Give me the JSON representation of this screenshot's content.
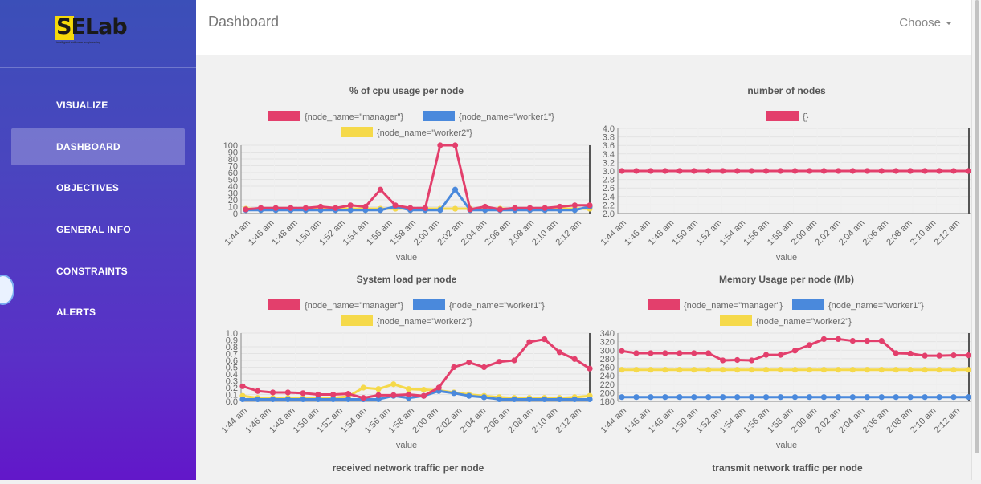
{
  "logo": {
    "text": "SELab",
    "tagline": "intelligent software engineering"
  },
  "sidebar": {
    "items": [
      {
        "label": "VISUALIZE",
        "active": false
      },
      {
        "label": "DASHBOARD",
        "active": true
      },
      {
        "label": "OBJECTIVES",
        "active": false
      },
      {
        "label": "GENERAL INFO",
        "active": false
      },
      {
        "label": "CONSTRAINTS",
        "active": false
      },
      {
        "label": "ALERTS",
        "active": false
      }
    ]
  },
  "header": {
    "title": "Dashboard",
    "choose_label": "Choose"
  },
  "colors": {
    "manager": "#e33f6c",
    "worker1": "#4a89dc",
    "worker2": "#f5d94a",
    "sidebar_top": "#3b4fb8",
    "sidebar_bottom": "#6217c9"
  },
  "footer_titles": [
    "received network traffic per node",
    "transmit network traffic per node"
  ],
  "chart_data": [
    {
      "type": "line",
      "title": "% of cpu usage per node",
      "xlabel": "value",
      "ylim": [
        0,
        100
      ],
      "yticks": [
        0,
        10,
        20,
        30,
        40,
        50,
        60,
        70,
        80,
        90,
        100
      ],
      "categories": [
        "1:44 am",
        "1:46 am",
        "1:48 am",
        "1:50 am",
        "1:52 am",
        "1:54 am",
        "1:56 am",
        "1:58 am",
        "2:00 am",
        "2:02 am",
        "2:04 am",
        "2:06 am",
        "2:08 am",
        "2:10 am",
        "2:12 am"
      ],
      "series": [
        {
          "name": "{node_name=\"manager\"}",
          "values": [
            6,
            8,
            8,
            8,
            8,
            10,
            8,
            12,
            10,
            35,
            12,
            8,
            8,
            100,
            100,
            6,
            10,
            6,
            8,
            8,
            8,
            10,
            12,
            12
          ]
        },
        {
          "name": "{node_name=\"worker1\"}",
          "values": [
            5,
            5,
            5,
            5,
            5,
            5,
            5,
            5,
            5,
            5,
            10,
            5,
            5,
            5,
            35,
            5,
            5,
            5,
            5,
            5,
            5,
            5,
            5,
            10
          ]
        },
        {
          "name": "{node_name=\"worker2\"}",
          "values": [
            7,
            7,
            7,
            7,
            7,
            7,
            7,
            7,
            7,
            7,
            7,
            7,
            7,
            7,
            7,
            7,
            7,
            7,
            7,
            7,
            7,
            7,
            7,
            7
          ]
        }
      ]
    },
    {
      "type": "line",
      "title": "number of nodes",
      "xlabel": "value",
      "ylim": [
        2.0,
        4.0
      ],
      "yticks": [
        2.0,
        2.2,
        2.4,
        2.6,
        2.8,
        3.0,
        3.2,
        3.4,
        3.6,
        3.8,
        4.0
      ],
      "categories": [
        "1:44 am",
        "1:46 am",
        "1:48 am",
        "1:50 am",
        "1:52 am",
        "1:54 am",
        "1:56 am",
        "1:58 am",
        "2:00 am",
        "2:02 am",
        "2:04 am",
        "2:06 am",
        "2:08 am",
        "2:10 am",
        "2:12 am"
      ],
      "series": [
        {
          "name": "{}",
          "values": [
            3,
            3,
            3,
            3,
            3,
            3,
            3,
            3,
            3,
            3,
            3,
            3,
            3,
            3,
            3,
            3,
            3,
            3,
            3,
            3,
            3,
            3,
            3,
            3,
            3
          ]
        }
      ]
    },
    {
      "type": "line",
      "title": "System load per node",
      "xlabel": "value",
      "ylim": [
        0,
        1.0
      ],
      "yticks": [
        0,
        0.1,
        0.2,
        0.3,
        0.4,
        0.5,
        0.6,
        0.7,
        0.8,
        0.9,
        1.0
      ],
      "categories": [
        "1:44 am",
        "1:46 am",
        "1:48 am",
        "1:50 am",
        "1:52 am",
        "1:54 am",
        "1:56 am",
        "1:58 am",
        "2:00 am",
        "2:02 am",
        "2:04 am",
        "2:06 am",
        "2:08 am",
        "2:10 am",
        "2:12 am"
      ],
      "series": [
        {
          "name": "{node_name=\"manager\"}",
          "values": [
            0.22,
            0.15,
            0.13,
            0.13,
            0.12,
            0.1,
            0.1,
            0.11,
            0.05,
            0.09,
            0.09,
            0.1,
            0.08,
            0.2,
            0.5,
            0.57,
            0.5,
            0.58,
            0.6,
            0.87,
            0.91,
            0.72,
            0.62,
            0.48
          ]
        },
        {
          "name": "{node_name=\"worker1\"}",
          "values": [
            0.03,
            0.03,
            0.03,
            0.03,
            0.03,
            0.03,
            0.03,
            0.03,
            0.03,
            0.03,
            0.08,
            0.05,
            0.08,
            0.15,
            0.12,
            0.08,
            0.06,
            0.03,
            0.03,
            0.03,
            0.03,
            0.03,
            0.03,
            0.03
          ]
        },
        {
          "name": "{node_name=\"worker2\"}",
          "values": [
            0.08,
            0.05,
            0.05,
            0.05,
            0.05,
            0.05,
            0.05,
            0.07,
            0.2,
            0.18,
            0.25,
            0.18,
            0.17,
            0.16,
            0.13,
            0.1,
            0.08,
            0.06,
            0.05,
            0.05,
            0.05,
            0.05,
            0.06,
            0.08
          ]
        }
      ]
    },
    {
      "type": "line",
      "title": "Memory Usage per node (Mb)",
      "xlabel": "value",
      "ylim": [
        180,
        340
      ],
      "yticks": [
        180,
        200,
        220,
        240,
        260,
        280,
        300,
        320,
        340
      ],
      "categories": [
        "1:44 am",
        "1:46 am",
        "1:48 am",
        "1:50 am",
        "1:52 am",
        "1:54 am",
        "1:56 am",
        "1:58 am",
        "2:00 am",
        "2:02 am",
        "2:04 am",
        "2:06 am",
        "2:08 am",
        "2:10 am",
        "2:12 am"
      ],
      "series": [
        {
          "name": "{node_name=\"manager\"}",
          "values": [
            298,
            293,
            293,
            293,
            293,
            293,
            293,
            276,
            277,
            276,
            289,
            289,
            299,
            312,
            326,
            326,
            322,
            322,
            322,
            293,
            292,
            287,
            287,
            288,
            288
          ]
        },
        {
          "name": "{node_name=\"worker1\"}",
          "values": [
            190,
            190,
            190,
            190,
            190,
            190,
            190,
            190,
            190,
            190,
            190,
            190,
            190,
            190,
            190,
            190,
            190,
            190,
            190,
            190,
            190,
            190,
            190,
            190,
            190
          ]
        },
        {
          "name": "{node_name=\"worker2\"}",
          "values": [
            254,
            254,
            254,
            254,
            254,
            254,
            254,
            254,
            254,
            254,
            254,
            254,
            254,
            254,
            254,
            254,
            254,
            254,
            254,
            254,
            254,
            254,
            254,
            254,
            254
          ]
        }
      ]
    }
  ]
}
